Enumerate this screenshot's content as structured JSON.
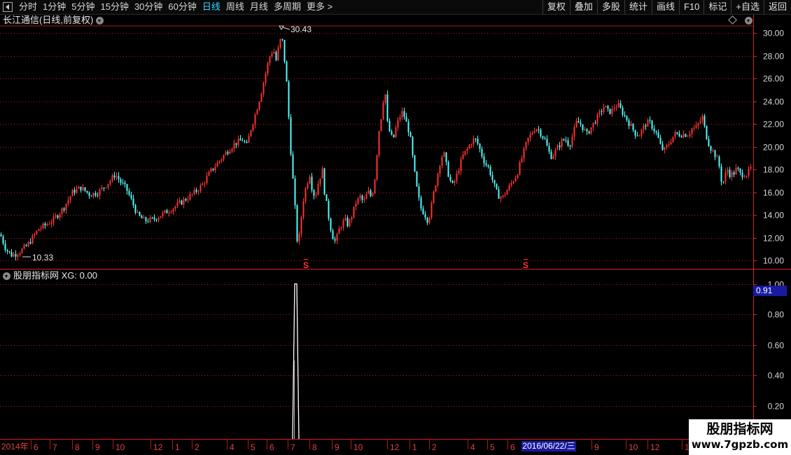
{
  "toolbar": {
    "period_tabs": [
      {
        "label": "分时",
        "active": false
      },
      {
        "label": "1分钟",
        "active": false
      },
      {
        "label": "5分钟",
        "active": false
      },
      {
        "label": "15分钟",
        "active": false
      },
      {
        "label": "30分钟",
        "active": false
      },
      {
        "label": "60分钟",
        "active": false
      },
      {
        "label": "日线",
        "active": true
      },
      {
        "label": "周线",
        "active": false
      },
      {
        "label": "月线",
        "active": false
      },
      {
        "label": "多周期",
        "active": false
      },
      {
        "label": "更多 >",
        "active": false
      }
    ],
    "right_buttons": [
      "复权",
      "叠加",
      "多股",
      "统计",
      "画线",
      "F10",
      "标记",
      "+自选",
      "返回"
    ]
  },
  "main_chart": {
    "title": "长江通信(日线,前复权)",
    "high_label": "30.43",
    "low_label": "10.33",
    "signal_marker": "S",
    "y_ticks": [
      "30.00",
      "28.00",
      "26.00",
      "24.00",
      "22.00",
      "20.00",
      "18.00",
      "16.00",
      "14.00",
      "12.00",
      "10.00"
    ],
    "up_color": "#ff3232",
    "down_color": "#54fcfc",
    "marker_color": "#ff3232"
  },
  "indicator": {
    "title": "股朋指标网 XG: 0.00",
    "y_ticks": [
      "1.00",
      "0.80",
      "0.60",
      "0.40",
      "0.20"
    ],
    "current_value": "0.91",
    "line_color": "#ffffff"
  },
  "time_axis": {
    "year_label": "2014年",
    "month_labels": [
      "6",
      "7",
      "8",
      "9",
      "10",
      "12",
      "1",
      "2",
      "4",
      "5",
      "6",
      "7",
      "8",
      "9",
      "10",
      "12",
      "1",
      "2",
      "4",
      "5",
      "6",
      "9",
      "10",
      "12",
      "1"
    ],
    "highlight_date": "2016/06/22/三"
  },
  "watermark": {
    "title": "股朋指标网",
    "url": "www.7gpzb.com"
  },
  "chart_data": {
    "type": "candlestick",
    "ylim": [
      9.6,
      31.2
    ],
    "price_anchors": [
      [
        0,
        12.3
      ],
      [
        8,
        11.0
      ],
      [
        16,
        10.5
      ],
      [
        22,
        10.6
      ],
      [
        30,
        10.9
      ],
      [
        38,
        11.3
      ],
      [
        46,
        12.0
      ],
      [
        55,
        12.8
      ],
      [
        64,
        13.1
      ],
      [
        76,
        13.6
      ],
      [
        90,
        14.6
      ],
      [
        104,
        16.1
      ],
      [
        115,
        16.4
      ],
      [
        128,
        15.8
      ],
      [
        140,
        16.0
      ],
      [
        150,
        16.6
      ],
      [
        158,
        17.1
      ],
      [
        164,
        17.6
      ],
      [
        172,
        16.9
      ],
      [
        180,
        16.3
      ],
      [
        188,
        15.2
      ],
      [
        196,
        14.0
      ],
      [
        206,
        13.5
      ],
      [
        218,
        13.6
      ],
      [
        232,
        14.1
      ],
      [
        246,
        14.6
      ],
      [
        260,
        15.2
      ],
      [
        274,
        15.8
      ],
      [
        288,
        16.6
      ],
      [
        300,
        17.8
      ],
      [
        312,
        18.7
      ],
      [
        324,
        19.6
      ],
      [
        335,
        20.3
      ],
      [
        346,
        20.6
      ],
      [
        352,
        20.1
      ],
      [
        358,
        21.6
      ],
      [
        364,
        22.8
      ],
      [
        372,
        24.6
      ],
      [
        378,
        26.2
      ],
      [
        384,
        27.8
      ],
      [
        390,
        28.6
      ],
      [
        394,
        27.6
      ],
      [
        398,
        28.9
      ],
      [
        402,
        29.8
      ],
      [
        406,
        27.6
      ],
      [
        409,
        25.6
      ],
      [
        412,
        22.6
      ],
      [
        415,
        19.6
      ],
      [
        418,
        17.1
      ],
      [
        421,
        14.6
      ],
      [
        423,
        12.6
      ],
      [
        425,
        11.1
      ],
      [
        428,
        12.6
      ],
      [
        432,
        15.1
      ],
      [
        437,
        16.6
      ],
      [
        442,
        17.6
      ],
      [
        446,
        16.1
      ],
      [
        450,
        15.6
      ],
      [
        455,
        17.1
      ],
      [
        460,
        17.9
      ],
      [
        463,
        16.1
      ],
      [
        467,
        14.6
      ],
      [
        471,
        13.1
      ],
      [
        475,
        12.1
      ],
      [
        479,
        11.6
      ],
      [
        483,
        12.6
      ],
      [
        487,
        13.1
      ],
      [
        492,
        13.6
      ],
      [
        497,
        13.1
      ],
      [
        503,
        14.1
      ],
      [
        508,
        15.1
      ],
      [
        514,
        15.6
      ],
      [
        519,
        15.1
      ],
      [
        525,
        16.1
      ],
      [
        530,
        15.6
      ],
      [
        534,
        16.6
      ],
      [
        537,
        18.6
      ],
      [
        540,
        21.1
      ],
      [
        544,
        22.6
      ],
      [
        547,
        24.1
      ],
      [
        550,
        24.6
      ],
      [
        553,
        22.1
      ],
      [
        557,
        21.1
      ],
      [
        561,
        20.6
      ],
      [
        565,
        21.6
      ],
      [
        570,
        22.6
      ],
      [
        575,
        23.1
      ],
      [
        580,
        22.1
      ],
      [
        585,
        21.1
      ],
      [
        589,
        19.1
      ],
      [
        593,
        17.1
      ],
      [
        597,
        15.6
      ],
      [
        601,
        14.6
      ],
      [
        606,
        14.1
      ],
      [
        610,
        13.6
      ],
      [
        614,
        14.1
      ],
      [
        618,
        15.6
      ],
      [
        623,
        17.1
      ],
      [
        628,
        18.6
      ],
      [
        633,
        19.6
      ],
      [
        638,
        18.1
      ],
      [
        642,
        17.1
      ],
      [
        646,
        16.6
      ],
      [
        650,
        17.1
      ],
      [
        655,
        18.1
      ],
      [
        660,
        19.1
      ],
      [
        665,
        19.6
      ],
      [
        670,
        20.1
      ],
      [
        675,
        20.6
      ],
      [
        680,
        20.6
      ],
      [
        686,
        19.6
      ],
      [
        692,
        18.6
      ],
      [
        698,
        18.1
      ],
      [
        703,
        17.1
      ],
      [
        708,
        16.1
      ],
      [
        713,
        15.6
      ],
      [
        718,
        15.6
      ],
      [
        723,
        16.1
      ],
      [
        728,
        16.6
      ],
      [
        733,
        17.1
      ],
      [
        738,
        17.6
      ],
      [
        743,
        18.6
      ],
      [
        748,
        19.6
      ],
      [
        753,
        20.6
      ],
      [
        758,
        21.1
      ],
      [
        763,
        21.6
      ],
      [
        768,
        21.6
      ],
      [
        773,
        21.1
      ],
      [
        778,
        20.6
      ],
      [
        783,
        19.6
      ],
      [
        788,
        19.1
      ],
      [
        793,
        19.6
      ],
      [
        798,
        20.1
      ],
      [
        803,
        20.6
      ],
      [
        808,
        20.6
      ],
      [
        813,
        20.1
      ],
      [
        818,
        21.1
      ],
      [
        823,
        22.1
      ],
      [
        828,
        22.1
      ],
      [
        833,
        21.6
      ],
      [
        838,
        21.1
      ],
      [
        843,
        21.6
      ],
      [
        848,
        22.1
      ],
      [
        853,
        22.6
      ],
      [
        858,
        23.1
      ],
      [
        863,
        23.6
      ],
      [
        868,
        23.1
      ],
      [
        873,
        23.1
      ],
      [
        878,
        23.6
      ],
      [
        883,
        23.6
      ],
      [
        888,
        23.1
      ],
      [
        893,
        22.6
      ],
      [
        898,
        22.1
      ],
      [
        903,
        21.6
      ],
      [
        908,
        21.1
      ],
      [
        913,
        21.1
      ],
      [
        918,
        21.6
      ],
      [
        923,
        22.1
      ],
      [
        928,
        22.1
      ],
      [
        933,
        21.6
      ],
      [
        938,
        21.1
      ],
      [
        943,
        20.1
      ],
      [
        948,
        19.6
      ],
      [
        953,
        20.1
      ],
      [
        958,
        20.6
      ],
      [
        963,
        21.1
      ],
      [
        968,
        21.1
      ],
      [
        973,
        21.1
      ],
      [
        978,
        21.1
      ],
      [
        983,
        21.1
      ],
      [
        988,
        21.6
      ],
      [
        993,
        21.6
      ],
      [
        998,
        22.1
      ],
      [
        1003,
        22.6
      ],
      [
        1008,
        21.1
      ],
      [
        1013,
        20.1
      ],
      [
        1018,
        19.6
      ],
      [
        1023,
        19.1
      ],
      [
        1028,
        18.1
      ],
      [
        1031,
        16.6
      ],
      [
        1034,
        17.1
      ],
      [
        1038,
        18.1
      ],
      [
        1042,
        17.6
      ],
      [
        1047,
        17.6
      ],
      [
        1052,
        18.1
      ],
      [
        1057,
        17.6
      ],
      [
        1062,
        17.6
      ],
      [
        1067,
        17.6
      ],
      [
        1072,
        18.1
      ],
      [
        1075,
        18.1
      ]
    ],
    "xg_signal": {
      "value": 1.0,
      "other_days": 0.0
    },
    "indicator_ylim": [
      0.05,
      1.05
    ]
  }
}
